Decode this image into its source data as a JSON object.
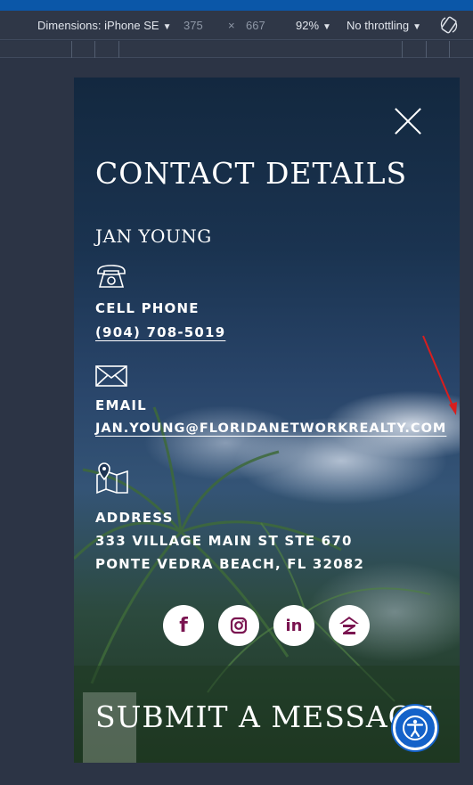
{
  "devtools": {
    "device": "Dimensions: iPhone SE",
    "width": "375",
    "times": "×",
    "height": "667",
    "zoom": "92%",
    "throttling": "No throttling"
  },
  "panel": {
    "heading": "CONTACT DETAILS",
    "agent_name": "JAN YOUNG",
    "phone_label": "CELL PHONE",
    "phone_value": "(904) 708-5019",
    "email_label": "EMAIL",
    "email_value": "JAN.YOUNG@FLORIDANETWORKREALTY.COM",
    "address_label": "ADDRESS",
    "address_line1": "333 VILLAGE MAIN ST STE 670",
    "address_line2": "PONTE VEDRA BEACH, FL 32082",
    "submit_heading": "SUBMIT A MESSAGE"
  },
  "social": {
    "facebook": "f",
    "linkedin": "in"
  },
  "colors": {
    "social_icon": "#7a1450",
    "accessibility_button": "#1462c9",
    "annotation_arrow": "#d81e1e"
  }
}
